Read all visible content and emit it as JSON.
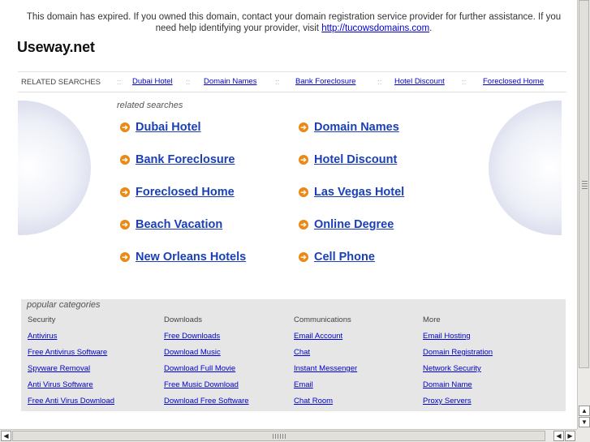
{
  "notice": {
    "text": "This domain has expired. If you owned this domain, contact your domain registration service provider for further assistance. If you need help identifying your provider, visit ",
    "link": "http://tucowsdomains.com",
    "end": "."
  },
  "domain_title": "Useway.net",
  "related_bar": {
    "label": "RELATED SEARCHES",
    "separator": "::",
    "links": [
      "Dubai Hotel",
      "Domain Names",
      "Bank Foreclosure",
      "Hotel Discount",
      "Foreclosed Home"
    ]
  },
  "related_searches": {
    "heading": "related searches",
    "left": [
      "Dubai Hotel",
      "Bank Foreclosure",
      "Foreclosed Home",
      "Beach Vacation",
      "New Orleans Hotels"
    ],
    "right": [
      "Domain Names",
      "Hotel Discount",
      "Las Vegas Hotel",
      "Online Degree",
      "Cell Phone"
    ]
  },
  "popular": {
    "title": "popular categories",
    "columns": [
      {
        "heading": "Security",
        "links": [
          "Antivirus",
          "Free Antivirus Software",
          "Spyware Removal",
          "Anti Virus Software",
          "Free Anti Virus Download"
        ]
      },
      {
        "heading": "Downloads",
        "links": [
          "Free Downloads",
          "Download Music",
          "Download Full Movie",
          "Free Music Download",
          "Download Free Software"
        ]
      },
      {
        "heading": "Communications",
        "links": [
          "Email Account",
          "Chat",
          "Instant Messenger",
          "Email",
          "Chat Room"
        ]
      },
      {
        "heading": "More",
        "links": [
          "Email Hosting",
          "Domain Registration",
          "Network Security",
          "Domain Name",
          "Proxy Servers"
        ]
      }
    ]
  },
  "icons": {
    "arrow": "orange-circle-arrow-icon",
    "scroll_up": "▲",
    "scroll_down": "▼",
    "scroll_left": "◀",
    "scroll_right": "▶"
  },
  "colors": {
    "link": "#0000cc",
    "big_link": "#1a3fb8",
    "arrow_bullet": "#e88a14",
    "popular_bg": "#e6e6e6"
  }
}
